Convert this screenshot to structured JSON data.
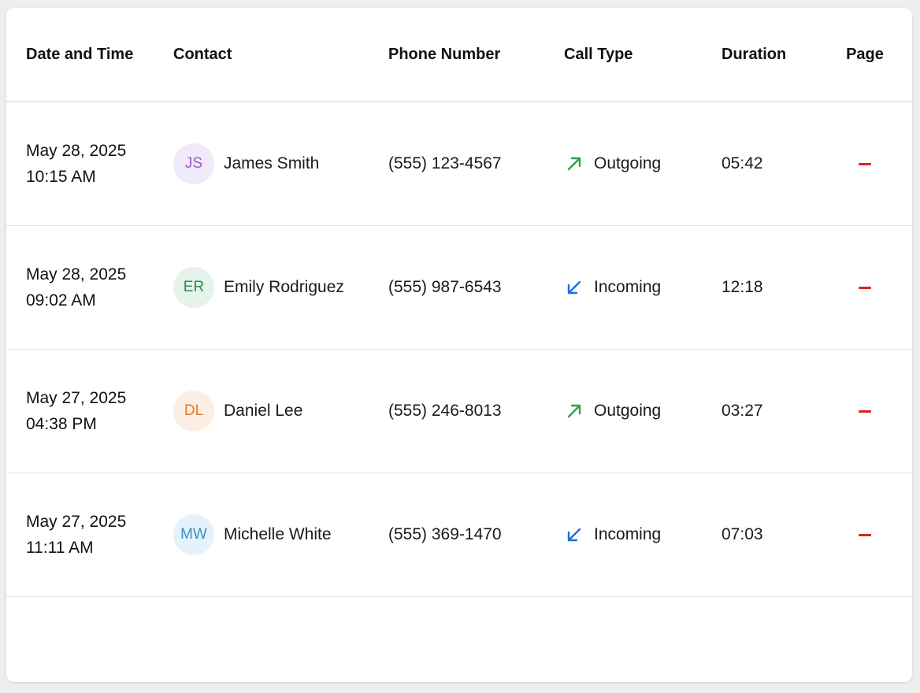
{
  "headers": {
    "date": "Date and Time",
    "contact": "Contact",
    "phone": "Phone Number",
    "type": "Call Type",
    "duration": "Duration",
    "page": "Page"
  },
  "rows": [
    {
      "date": "May 28, 2025",
      "time": "10:15 AM",
      "initials": "JS",
      "name": "James Smith",
      "phone": "(555) 123-4567",
      "type": "Outgoing",
      "duration": "05:42",
      "avatar_bg": "#f1eafa",
      "avatar_fg": "#9b59c6"
    },
    {
      "date": "May 28, 2025",
      "time": "09:02 AM",
      "initials": "ER",
      "name": "Emily Rodriguez",
      "phone": "(555) 987-6543",
      "type": "Incoming",
      "duration": "12:18",
      "avatar_bg": "#e6f3ea",
      "avatar_fg": "#2e8b4a"
    },
    {
      "date": "May 27, 2025",
      "time": "04:38 PM",
      "initials": "DL",
      "name": "Daniel Lee",
      "phone": "(555) 246-8013",
      "type": "Outgoing",
      "duration": "03:27",
      "avatar_bg": "#fdeee3",
      "avatar_fg": "#e07b2e"
    },
    {
      "date": "May 27, 2025",
      "time": "11:11 AM",
      "initials": "MW",
      "name": "Michelle White",
      "phone": "(555) 369-1470",
      "type": "Incoming",
      "duration": "07:03",
      "avatar_bg": "#e6f2fb",
      "avatar_fg": "#3a8fc2"
    }
  ],
  "colors": {
    "outgoing": "#2ea043",
    "incoming": "#1f6fe0",
    "page_dash": "#e02020"
  }
}
